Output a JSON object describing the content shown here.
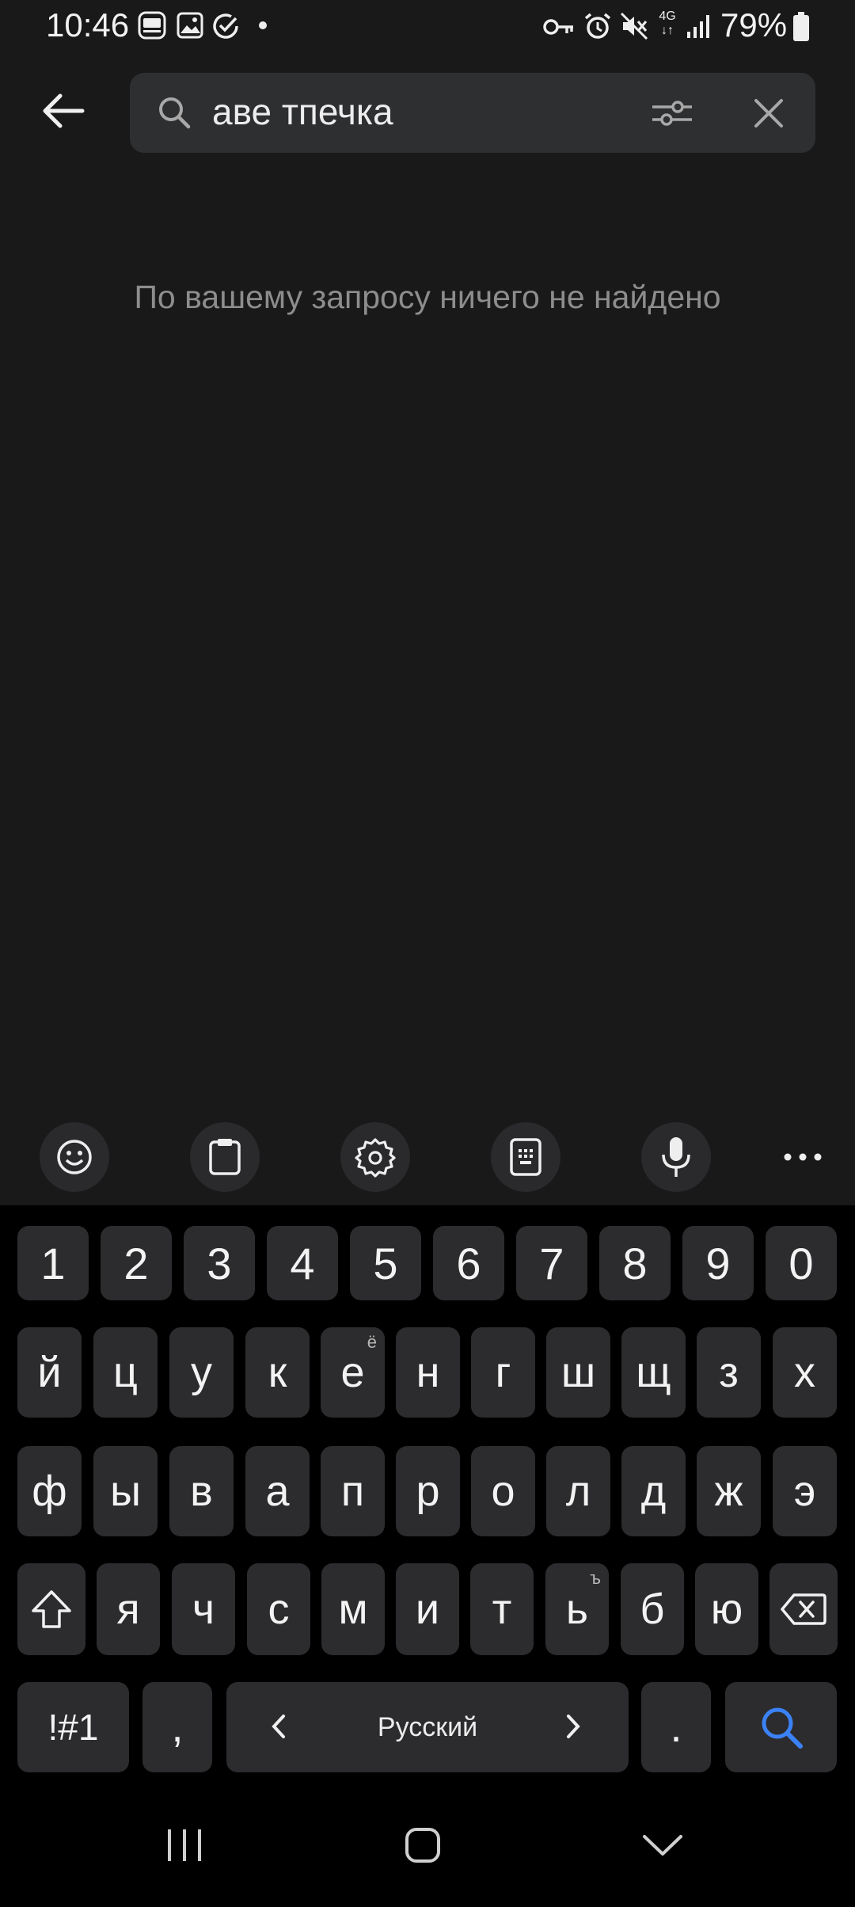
{
  "status_bar": {
    "time": "10:46",
    "battery_pct": "79%",
    "network": "4G",
    "icons": [
      "ad-blocker-icon",
      "gallery-icon",
      "check-circle-icon",
      "dot-icon",
      "key-icon",
      "alarm-icon",
      "mute-icon",
      "network-4g-icon",
      "signal-icon",
      "battery-icon"
    ]
  },
  "search": {
    "query": "аве тпечка",
    "icons": [
      "back-arrow-icon",
      "search-icon",
      "filter-sliders-icon",
      "close-icon"
    ]
  },
  "results": {
    "empty_message": "По вашему запросу ничего не найдено"
  },
  "keyboard": {
    "toolbar": [
      "emoji-icon",
      "clipboard-icon",
      "settings-icon",
      "keyboard-layout-icon",
      "microphone-icon",
      "more-icon"
    ],
    "number_row": [
      "1",
      "2",
      "3",
      "4",
      "5",
      "6",
      "7",
      "8",
      "9",
      "0"
    ],
    "row1": [
      "й",
      "ц",
      "у",
      "к",
      "е",
      "н",
      "г",
      "ш",
      "щ",
      "з",
      "х"
    ],
    "row1_alt_e": "ё",
    "row2": [
      "ф",
      "ы",
      "в",
      "а",
      "п",
      "р",
      "о",
      "л",
      "д",
      "ж",
      "э"
    ],
    "row3": [
      "я",
      "ч",
      "с",
      "м",
      "и",
      "т",
      "ь",
      "б",
      "ю"
    ],
    "row3_alt_soft": "ъ",
    "symbols_label": "!#1",
    "comma": ",",
    "space_label": "Русский",
    "period": ".",
    "accent_color": "#3b82f6"
  },
  "nav": {
    "icons": [
      "recent-apps-icon",
      "home-icon",
      "hide-keyboard-icon"
    ]
  }
}
